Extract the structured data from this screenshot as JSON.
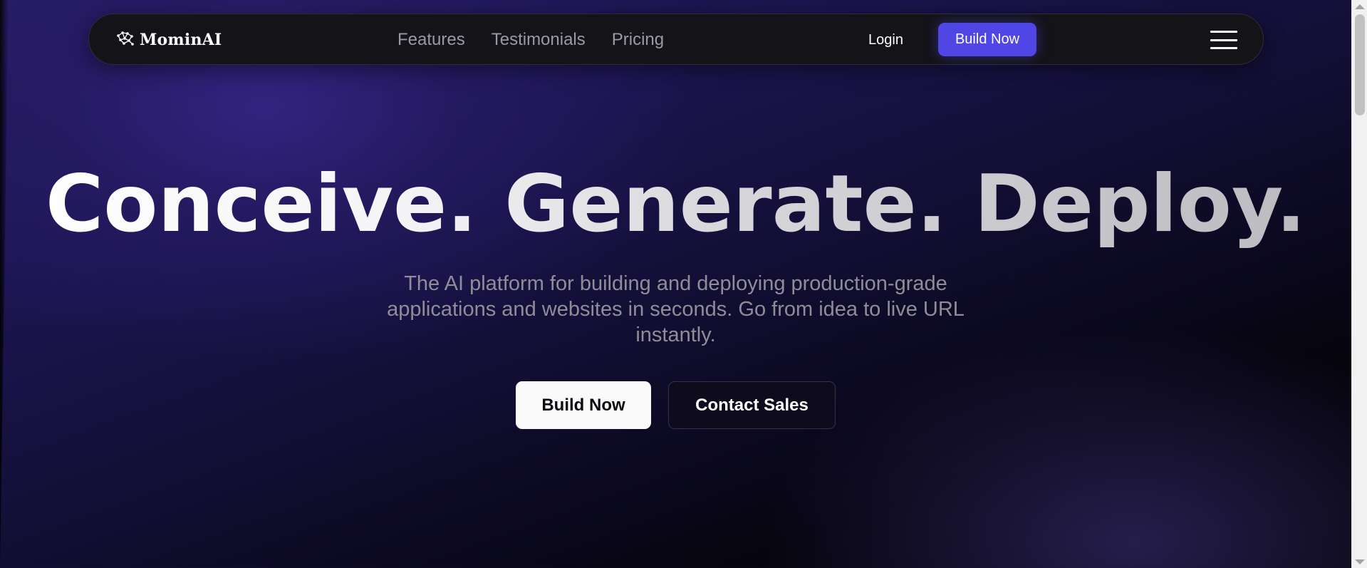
{
  "nav": {
    "logo_icon": "brain-network-icon",
    "brand": "MominAI",
    "links": [
      "Features",
      "Testimonials",
      "Pricing"
    ],
    "login": "Login",
    "cta": "Build Now",
    "menu_icon": "hamburger-menu-icon"
  },
  "hero": {
    "title": "Conceive. Generate. Deploy.",
    "subtitle": "The AI platform for building and deploying production-grade applications and websites in seconds. Go from idea to live URL instantly.",
    "primary_button": "Build Now",
    "secondary_button": "Contact Sales"
  },
  "colors": {
    "accent": "#4f46e5",
    "background_top": "#261c64",
    "background_bottom": "#030307",
    "navbar": "#141318"
  }
}
